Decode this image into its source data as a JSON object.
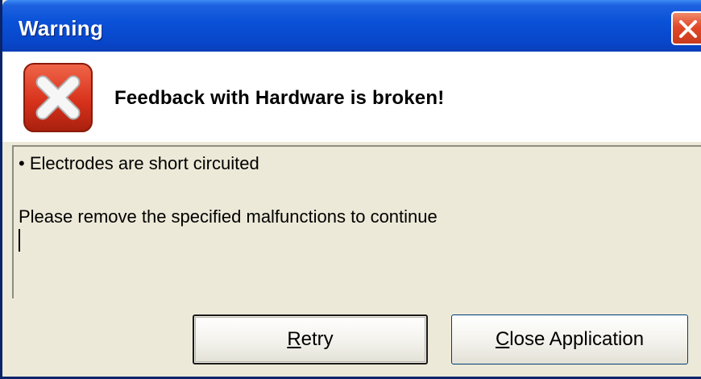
{
  "window": {
    "title": "Warning"
  },
  "header": {
    "heading": "Feedback with Hardware is broken!"
  },
  "message": {
    "line1": "• Electrodes are short circuited",
    "line2": "Please remove the specified malfunctions to continue"
  },
  "buttons": {
    "retry": {
      "mnemonic": "R",
      "rest": "etry"
    },
    "close_app": {
      "mnemonic": "C",
      "rest": "lose Application"
    }
  },
  "icons": {
    "close": "close-icon",
    "error": "error-icon"
  },
  "colors": {
    "titlebar": "#0A52D8",
    "close_button": "#E2492A",
    "error_icon": "#D8321C",
    "dialog_bg": "#ECE9D8"
  }
}
